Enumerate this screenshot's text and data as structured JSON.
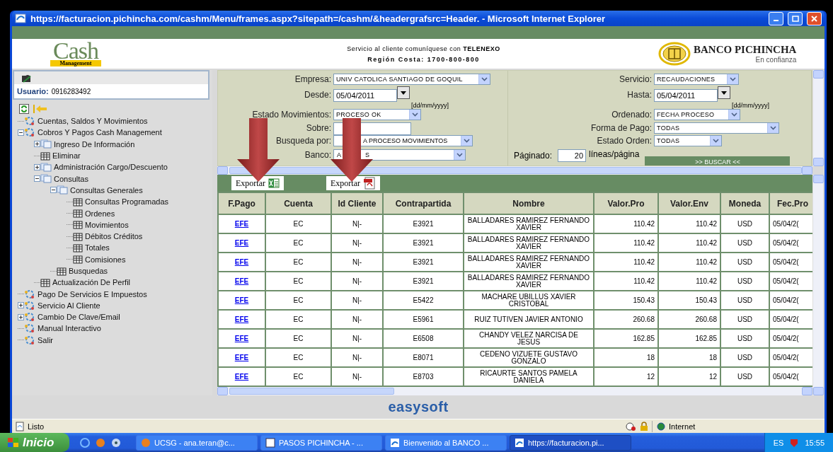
{
  "window": {
    "title": "https://facturacion.pichincha.com/cashm/Menu/frames.aspx?sitepath=/cashm/&headergrafsrc=Header. - Microsoft Internet Explorer"
  },
  "header": {
    "logo_word": "Cash",
    "logo_tag": "Management",
    "service_line": "Servicio al cliente comuníquese con **TELENEXO**",
    "phone_line": "Región Costa: 1700-800-800",
    "bank_name": "BANCO PICHINCHA",
    "bank_slogan": "En confianza"
  },
  "sidebar": {
    "user_label": "Usuario:",
    "user_value": "0916283492",
    "tree": [
      {
        "label": "Cuentas, Saldos Y Movimientos",
        "kind": "module"
      },
      {
        "label": "Cobros Y Pagos Cash Management",
        "kind": "module",
        "expanded": true,
        "children": [
          {
            "label": "Ingreso De Información",
            "kind": "section",
            "expanded": false
          },
          {
            "label": "Eliminar",
            "kind": "page"
          },
          {
            "label": "Administración Cargo/Descuento",
            "kind": "section",
            "expanded": false
          },
          {
            "label": "Consultas",
            "kind": "section",
            "expanded": true,
            "children": [
              {
                "label": "Consultas Generales",
                "kind": "section",
                "expanded": true,
                "children": [
                  {
                    "label": "Consultas Programadas",
                    "kind": "page"
                  },
                  {
                    "label": "Ordenes",
                    "kind": "page"
                  },
                  {
                    "label": "Movimientos",
                    "kind": "page"
                  },
                  {
                    "label": "Débitos Créditos",
                    "kind": "page"
                  },
                  {
                    "label": "Totales",
                    "kind": "page"
                  },
                  {
                    "label": "Comisiones",
                    "kind": "page"
                  }
                ]
              },
              {
                "label": "Busquedas",
                "kind": "page"
              }
            ]
          },
          {
            "label": "Actualización De Perfil",
            "kind": "page"
          }
        ]
      },
      {
        "label": "Pago De Servicios E Impuestos",
        "kind": "module"
      },
      {
        "label": "Servicio Al Cliente",
        "kind": "module",
        "expanded": false
      },
      {
        "label": "Cambio De Clave/Email",
        "kind": "module",
        "expanded": false
      },
      {
        "label": "Manual Interactivo",
        "kind": "module"
      },
      {
        "label": "Salir",
        "kind": "module"
      }
    ]
  },
  "filters": {
    "left": [
      {
        "label": "Empresa:",
        "kind": "select",
        "value": "UNIV CATOLICA SANTIAGO DE GOQUIL"
      },
      {
        "label": "Desde:",
        "kind": "date",
        "value": "05/04/2011",
        "hint": "[dd/mm/yyyy]"
      },
      {
        "label": "Estado Movimientos:",
        "kind": "select",
        "value": "PROCESO OK"
      },
      {
        "label": "Sobre:",
        "kind": "text"
      },
      {
        "label": "Busqueda por:",
        "kind": "select",
        "value_parts": [
          "A PROCESO MOVIMIENTOS"
        ]
      },
      {
        "label": "Banco:",
        "kind": "select",
        "value_parts": [
          "A",
          "S"
        ]
      }
    ],
    "right": [
      {
        "label": "Servicio:",
        "kind": "select",
        "value": "RECAUDACIONES"
      },
      {
        "label": "Hasta:",
        "kind": "date",
        "value": "05/04/2011",
        "hint": "[dd/mm/yyyy]"
      },
      {
        "label": "Ordenado:",
        "kind": "select",
        "value": "FECHA PROCESO"
      },
      {
        "label": "Forma de Pago:",
        "kind": "select",
        "value": "TODAS"
      },
      {
        "label": "Estado Orden:",
        "kind": "select",
        "value": "TODAS"
      },
      {
        "label": "Páginado:",
        "kind": "paging",
        "value": "20",
        "unit": "líneas/página",
        "button": ">> BUSCAR <<"
      }
    ]
  },
  "exports": [
    {
      "label": "Exportar",
      "kind": "excel"
    },
    {
      "label": "Exportar",
      "kind": "pdf"
    }
  ],
  "table": {
    "columns": [
      "F.Pago",
      "Cuenta",
      "Id Cliente",
      "Contrapartida",
      "Nombre",
      "Valor.Pro",
      "Valor.Env",
      "Moneda",
      "Fec.Pro"
    ],
    "rows": [
      [
        "EFE",
        "EC",
        "N|-",
        "E3921",
        "BALLADARES RAMIREZ FERNANDO XAVIER",
        "110.42",
        "110.42",
        "USD",
        "05/04/2("
      ],
      [
        "EFE",
        "EC",
        "N|-",
        "E3921",
        "BALLADARES RAMIREZ FERNANDO XAVIER",
        "110.42",
        "110.42",
        "USD",
        "05/04/2("
      ],
      [
        "EFE",
        "EC",
        "N|-",
        "E3921",
        "BALLADARES RAMIREZ FERNANDO XAVIER",
        "110.42",
        "110.42",
        "USD",
        "05/04/2("
      ],
      [
        "EFE",
        "EC",
        "N|-",
        "E3921",
        "BALLADARES RAMIREZ FERNANDO XAVIER",
        "110.42",
        "110.42",
        "USD",
        "05/04/2("
      ],
      [
        "EFE",
        "EC",
        "N|-",
        "E5422",
        "MACHARE UBILLUS XAVIER CRISTOBAL",
        "150.43",
        "150.43",
        "USD",
        "05/04/2("
      ],
      [
        "EFE",
        "EC",
        "N|-",
        "E5961",
        "RUIZ TUTIVEN JAVIER ANTONIO",
        "260.68",
        "260.68",
        "USD",
        "05/04/2("
      ],
      [
        "EFE",
        "EC",
        "N|-",
        "E6508",
        "CHANDY VELEZ NARCISA DE JESUS",
        "162.85",
        "162.85",
        "USD",
        "05/04/2("
      ],
      [
        "EFE",
        "EC",
        "N|-",
        "E8071",
        "CEDENO VIZUETE GUSTAVO GONZALO",
        "18",
        "18",
        "USD",
        "05/04/2("
      ],
      [
        "EFE",
        "EC",
        "N|-",
        "E8703",
        "RICAURTE SANTOS PAMELA DANIELA",
        "12",
        "12",
        "USD",
        "05/04/2("
      ]
    ]
  },
  "footer_logo": "easysoft",
  "status_bar": {
    "text": "Listo",
    "zone": "Internet"
  },
  "taskbar": {
    "start": "Inicio",
    "tasks": [
      {
        "label": "UCSG - ana.teran@c...",
        "kind": "browser",
        "selected": false
      },
      {
        "label": "PASOS PICHINCHA - ...",
        "kind": "document",
        "selected": false
      },
      {
        "label": "Bienvenido al BANCO ...",
        "kind": "explorer",
        "selected": false
      },
      {
        "label": "https://facturacion.pi...",
        "kind": "explorer",
        "selected": true
      }
    ],
    "language": "ES",
    "time": "15:55"
  }
}
